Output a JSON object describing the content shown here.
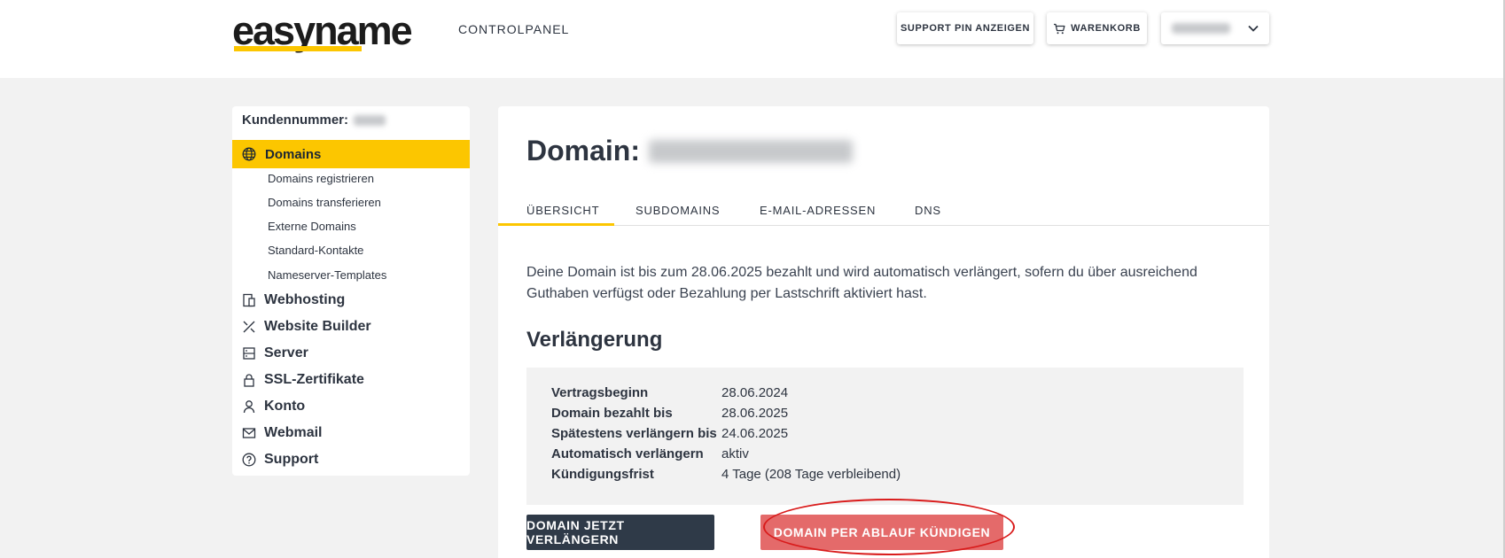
{
  "header": {
    "logo_text": "easyname",
    "section_label": "CONTROLPANEL",
    "support_pin_label": "SUPPORT PIN ANZEIGEN",
    "cart_label": "WARENKORB",
    "cart_icon": "cart-icon",
    "user_dropdown_icon": "chevron-down-icon"
  },
  "sidebar": {
    "customer_number_label": "Kundennummer:",
    "active": {
      "label": "Domains",
      "icon": "globe-icon"
    },
    "sub_items": [
      "Domains registrieren",
      "Domains transferieren",
      "Externe Domains",
      "Standard-Kontakte",
      "Nameserver-Templates"
    ],
    "items": [
      {
        "label": "Webhosting",
        "icon": "webhosting-icon"
      },
      {
        "label": "Website Builder",
        "icon": "tools-icon"
      },
      {
        "label": "Server",
        "icon": "server-icon"
      },
      {
        "label": "SSL-Zertifikate",
        "icon": "lock-icon"
      },
      {
        "label": "Konto",
        "icon": "user-icon"
      },
      {
        "label": "Webmail",
        "icon": "mail-icon"
      },
      {
        "label": "Support",
        "icon": "help-icon"
      }
    ]
  },
  "main": {
    "title": "Domain:",
    "tabs": [
      "ÜBERSICHT",
      "SUBDOMAINS",
      "E-MAIL-ADRESSEN",
      "DNS"
    ],
    "active_tab": "ÜBERSICHT",
    "intro_line1": "Deine Domain ist bis zum 28.06.2025 bezahlt und wird automatisch verlängert, sofern du über ausreichend",
    "intro_line2": "Guthaben verfügst oder Bezahlung per Lastschrift aktiviert hast.",
    "section_title": "Verlängerung",
    "details": [
      {
        "key": "Vertragsbeginn",
        "value": "28.06.2024"
      },
      {
        "key": "Domain bezahlt bis",
        "value": "28.06.2025"
      },
      {
        "key": "Spätestens verlängern bis",
        "value": "24.06.2025"
      },
      {
        "key": "Automatisch verlängern",
        "value": "aktiv"
      },
      {
        "key": "Kündigungsfrist",
        "value": "4 Tage (208 Tage verbleibend)"
      }
    ],
    "renew_button": "DOMAIN JETZT VERLÄNGERN",
    "cancel_button": "DOMAIN PER ABLAUF KÜNDIGEN"
  },
  "colors": {
    "accent": "#fcc600",
    "dark_button": "#2f3a48",
    "cancel_button": "#e46a6a",
    "highlight_ring": "#d91c1c"
  }
}
